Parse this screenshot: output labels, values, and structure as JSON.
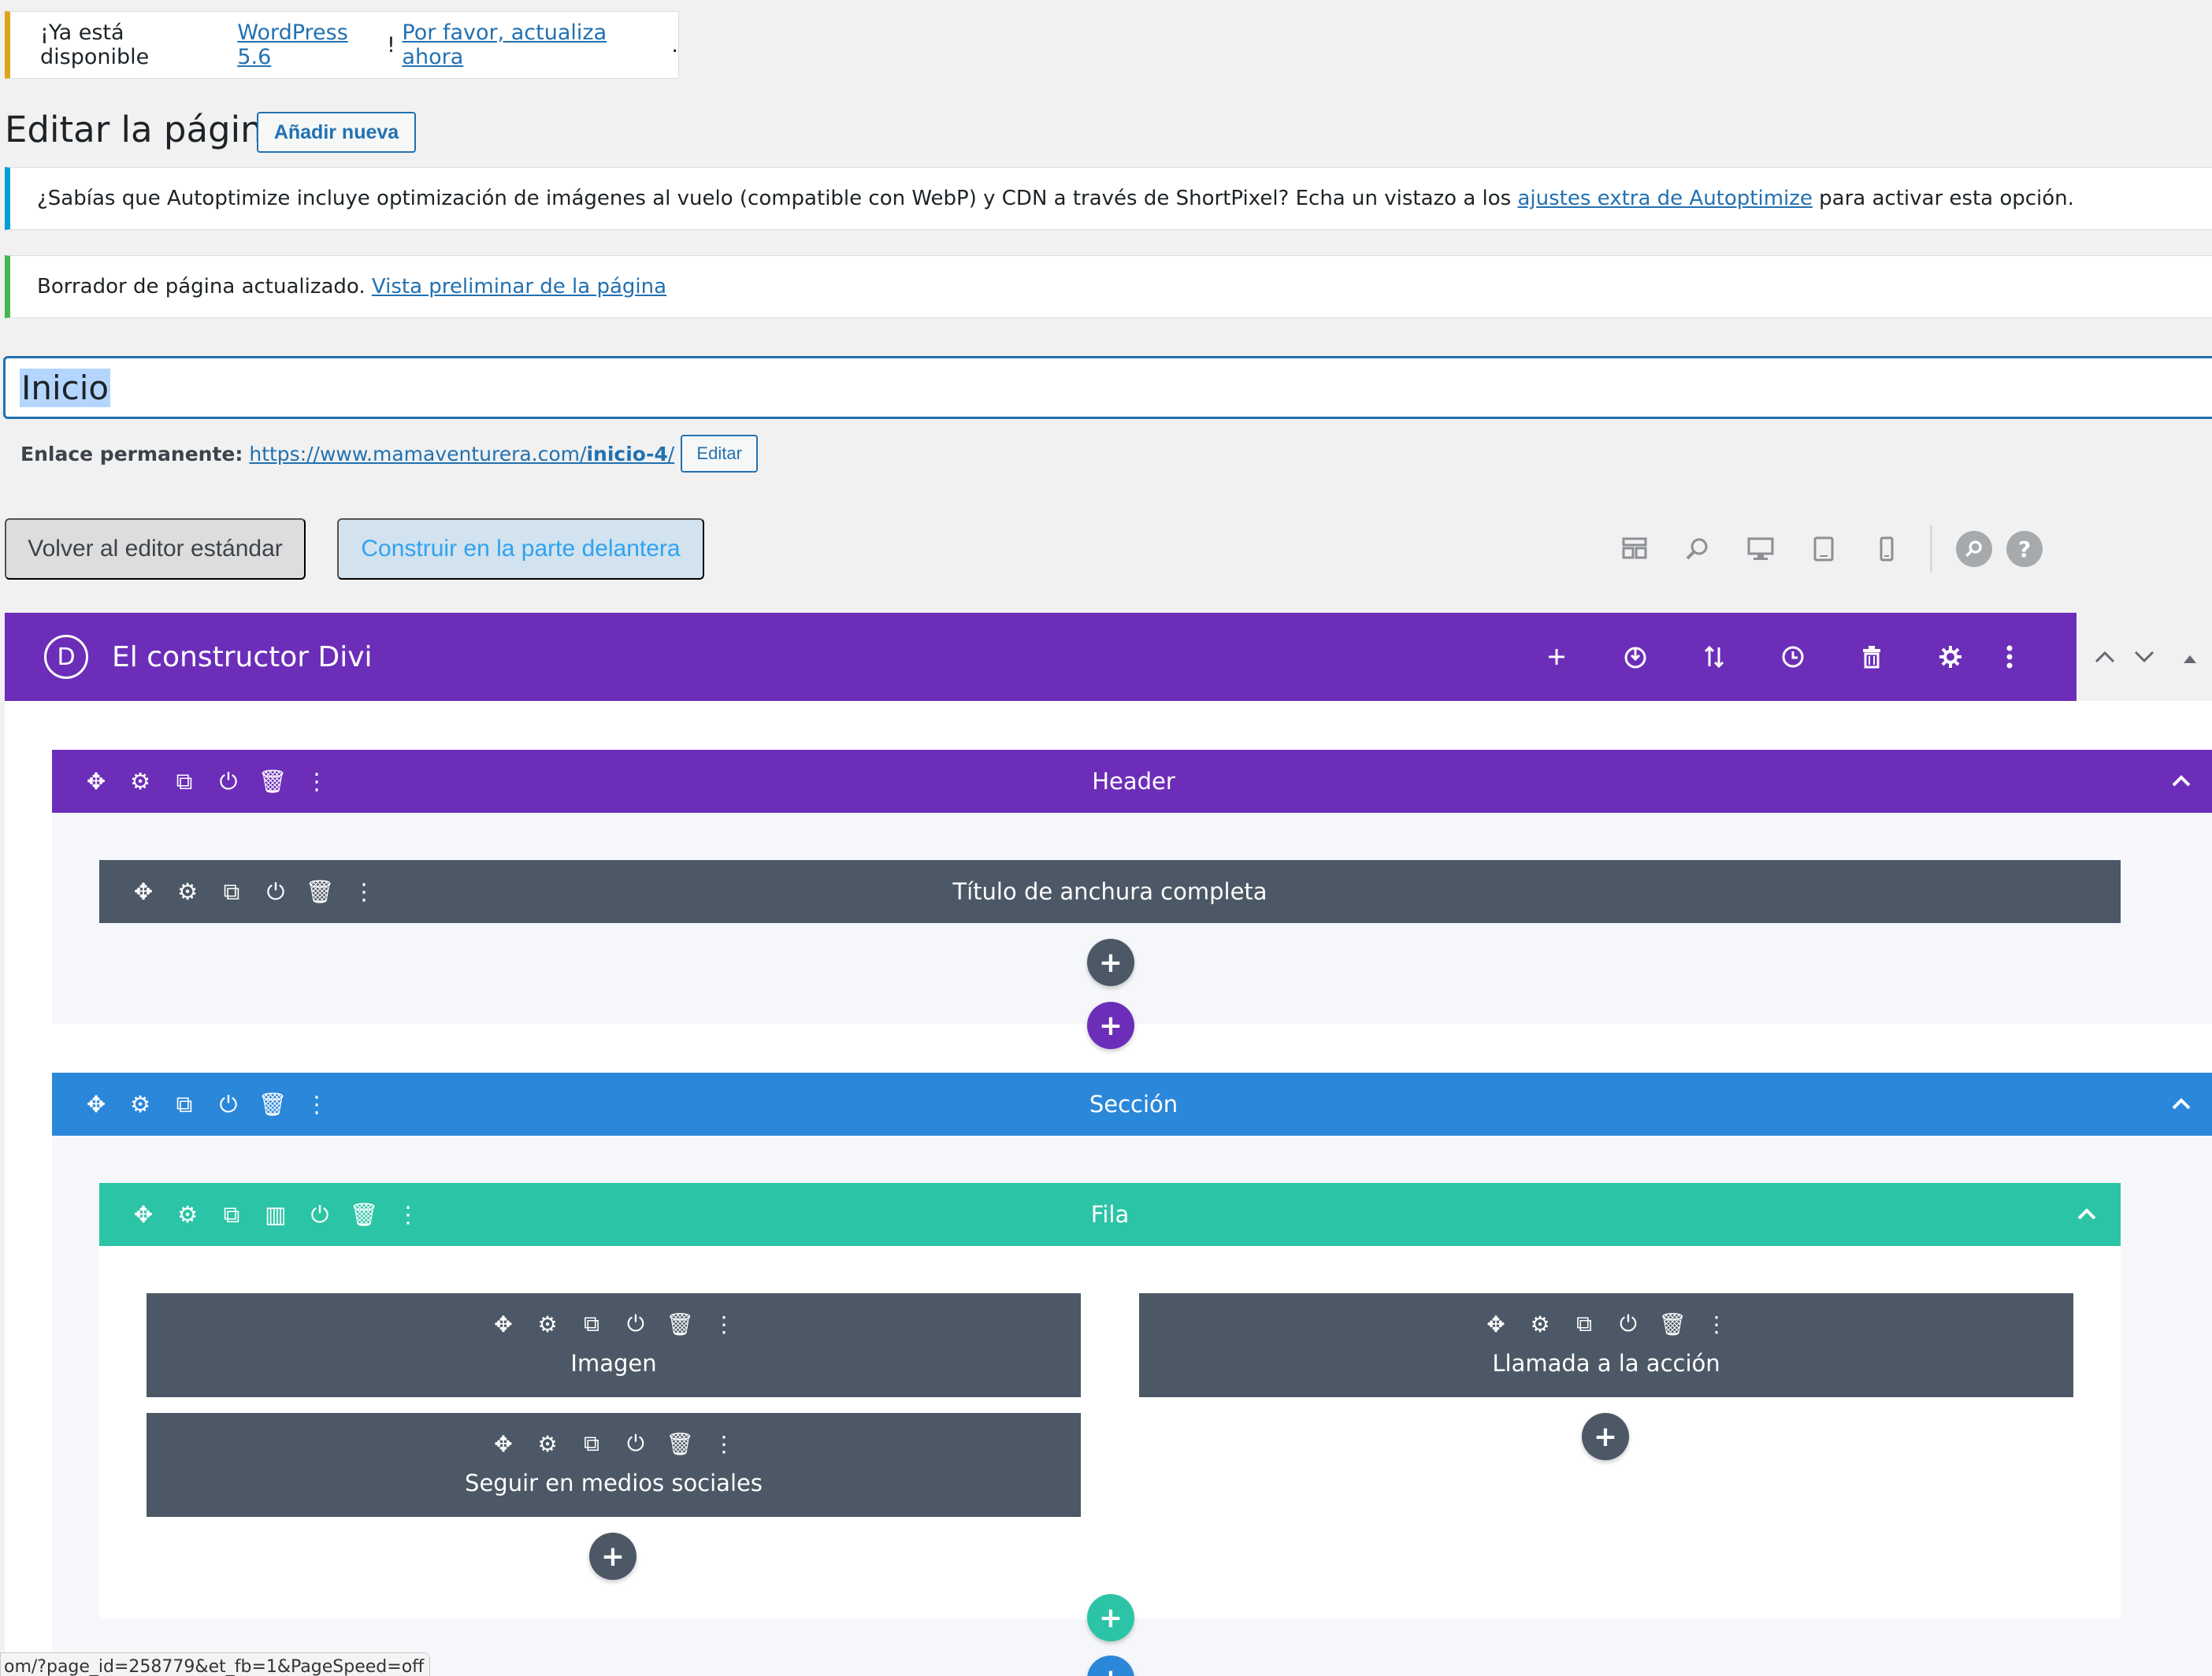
{
  "update_notice": {
    "prefix": "¡Ya está disponible ",
    "version_link": "WordPress 5.6",
    "exclaim": "! ",
    "update_link": "Por favor, actualiza ahora",
    "suffix": "."
  },
  "page": {
    "title": "Editar la página",
    "add_new": "Añadir nueva"
  },
  "autoptimize_notice": {
    "text": "¿Sabías que Autoptimize incluye optimización de imágenes al vuelo (compatible con WebP) y CDN a través de ShortPixel? Echa un vistazo a los ",
    "link": "ajustes extra de Autoptimize",
    "suffix": " para activar esta opción."
  },
  "draft_notice": {
    "text": "Borrador de página actualizado. ",
    "link": "Vista preliminar de la página"
  },
  "post_title": "Inicio",
  "permalink": {
    "label": "Enlace permanente:",
    "url_base": "https://www.mamaventurera.com/",
    "slug": "inicio-4",
    "url_end": "/",
    "edit": "Editar"
  },
  "editor_buttons": {
    "standard": "Volver al editor estándar",
    "front": "Construir en la parte delantera"
  },
  "divi": {
    "logo": "D",
    "title": "El constructor Divi"
  },
  "builder": {
    "header_section": "Header",
    "fullwidth_module": "Título de anchura completa",
    "section": "Sección",
    "row": "Fila",
    "modules": {
      "image": "Imagen",
      "cta": "Llamada a la acción",
      "social": "Seguir en medios sociales"
    }
  },
  "status_url": "om/?page_id=258779&et_fb=1&PageSpeed=off",
  "colors": {
    "divi_purple": "#6c2eb9",
    "section_blue": "#2b87da",
    "row_teal": "#2cc4a6",
    "module_gray": "#4c5866",
    "link_blue": "#2271b1"
  }
}
